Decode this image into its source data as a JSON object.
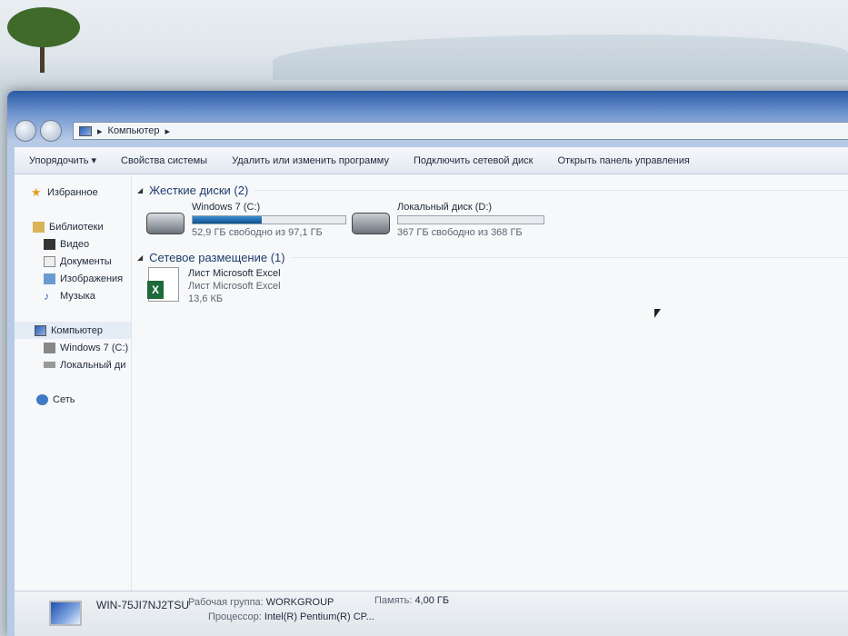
{
  "address": {
    "path": "Компьютер"
  },
  "toolbar": {
    "organize": "Упорядочить ▾",
    "system_properties": "Свойства системы",
    "uninstall": "Удалить или изменить программу",
    "map_drive": "Подключить сетевой диск",
    "control_panel": "Открыть панель управления"
  },
  "sidebar": {
    "favorites": "Избранное",
    "libraries": "Библиотеки",
    "video": "Видео",
    "documents": "Документы",
    "images": "Изображения",
    "music": "Музыка",
    "computer": "Компьютер",
    "drive_c": "Windows 7 (C:)",
    "drive_d": "Локальный ди",
    "network": "Сеть"
  },
  "groups": {
    "hard_disks": "Жесткие диски (2)",
    "network_locations": "Сетевое размещение (1)"
  },
  "drives": [
    {
      "name": "Windows 7 (C:)",
      "free": "52,9 ГБ свободно из 97,1 ГБ",
      "used_percent": 45.5
    },
    {
      "name": "Локальный диск (D:)",
      "free": "367 ГБ свободно из 368 ГБ",
      "used_percent": 0.3
    }
  ],
  "network_item": {
    "name": "Лист Microsoft Excel",
    "type": "Лист Microsoft Excel",
    "size": "13,6 КБ"
  },
  "status": {
    "computer_name": "WIN-75JI7NJ2TSU",
    "workgroup_label": "Рабочая группа:",
    "workgroup": "WORKGROUP",
    "memory_label": "Память:",
    "memory": "4,00 ГБ",
    "cpu_label": "Процессор:",
    "cpu": "Intel(R) Pentium(R) CP..."
  }
}
